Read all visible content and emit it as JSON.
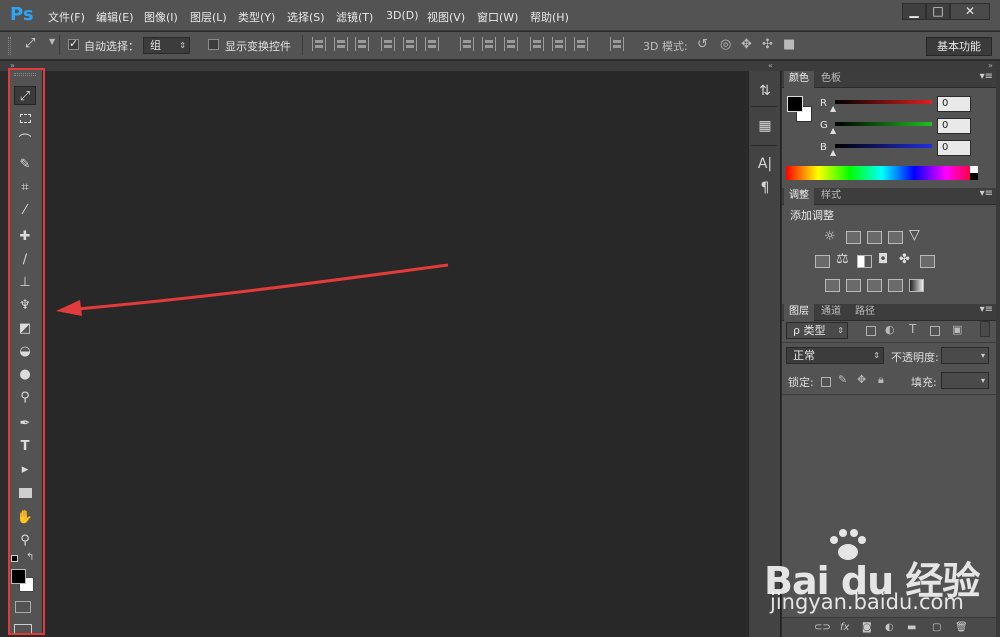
{
  "app": {
    "logo": "Ps"
  },
  "menu": [
    "文件(F)",
    "编辑(E)",
    "图像(I)",
    "图层(L)",
    "类型(Y)",
    "选择(S)",
    "滤镜(T)",
    "3D(D)",
    "视图(V)",
    "窗口(W)",
    "帮助(H)"
  ],
  "window_controls": {
    "minimize": "▁",
    "maximize": "□",
    "close": "✕"
  },
  "options_bar": {
    "auto_select_label": "自动选择：",
    "auto_select_checked": true,
    "auto_select_value": "组",
    "show_transform_label": "显示变换控件",
    "show_transform_checked": false,
    "mode_3d_label": "3D 模式:",
    "workspace": "基本功能"
  },
  "tools": [
    "move",
    "marquee",
    "lasso",
    "quick-select",
    "crop",
    "eyedropper",
    "healing",
    "brush",
    "stamp",
    "history-brush",
    "eraser",
    "paint-bucket",
    "blur",
    "dodge",
    "pen",
    "type",
    "path-select",
    "rectangle",
    "hand",
    "zoom"
  ],
  "tool_glyphs": {
    "type": "T"
  },
  "color_panel": {
    "tabs": [
      "颜色",
      "色板"
    ],
    "active_tab": "颜色",
    "channels": [
      {
        "name": "R",
        "value": "0",
        "color": "#e02020"
      },
      {
        "name": "G",
        "value": "0",
        "color": "#20c020"
      },
      {
        "name": "B",
        "value": "0",
        "color": "#2030e0"
      }
    ]
  },
  "adjustments_panel": {
    "tabs": [
      "调整",
      "样式"
    ],
    "active_tab": "调整",
    "title": "添加调整"
  },
  "layers_panel": {
    "tabs": [
      "图层",
      "通道",
      "路径"
    ],
    "active_tab": "图层",
    "filter_kind": "ρ 类型",
    "blend_mode": "正常",
    "opacity_label": "不透明度:",
    "lock_label": "锁定:",
    "fill_label": "填充:"
  },
  "watermark": {
    "brand": "Bai du 经验",
    "url": "jingyan.baidu.com"
  },
  "annotation": {
    "color": "#e23b3b"
  }
}
